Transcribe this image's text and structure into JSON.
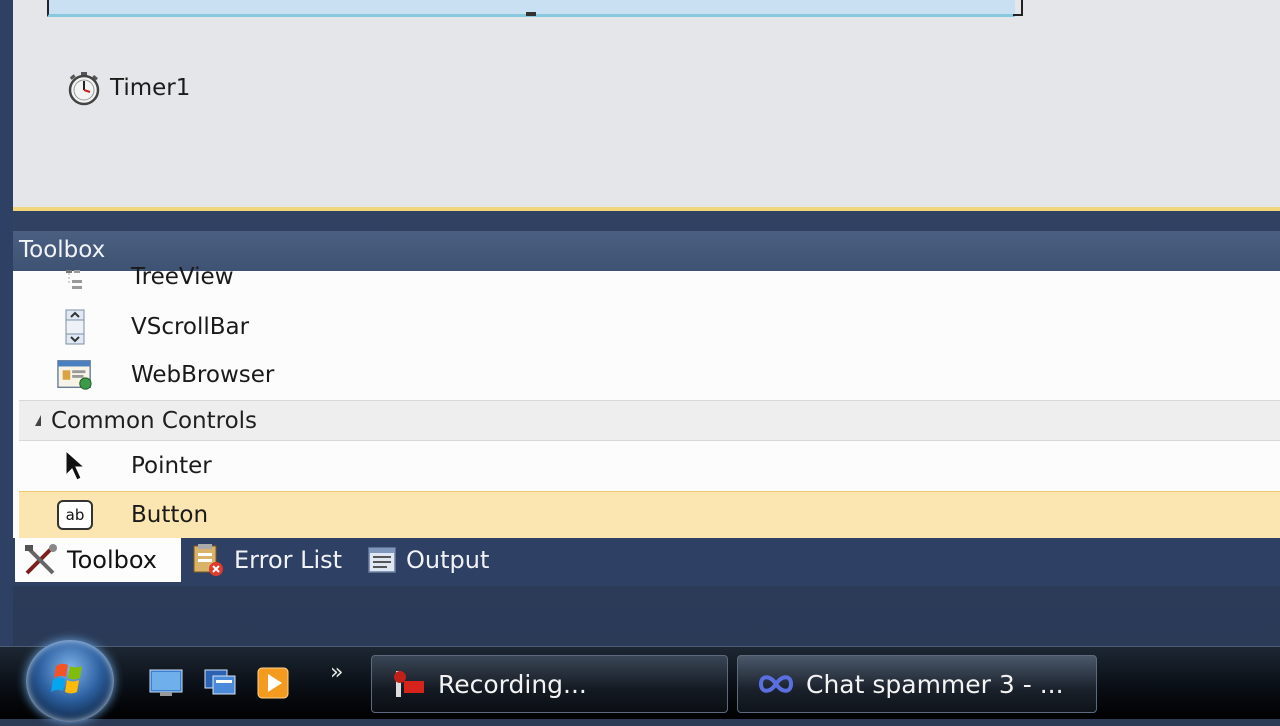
{
  "designer": {
    "component_tray": {
      "timer_label": "Timer1"
    }
  },
  "toolbox": {
    "title": "Toolbox",
    "items_above": [
      {
        "label": "TreeView",
        "icon": "treeview-icon"
      },
      {
        "label": "VScrollBar",
        "icon": "vscrollbar-icon"
      },
      {
        "label": "WebBrowser",
        "icon": "webbrowser-icon"
      }
    ],
    "group": {
      "label": "Common Controls"
    },
    "group_items": [
      {
        "label": "Pointer",
        "icon": "pointer-icon"
      },
      {
        "label": "Button",
        "icon": "button-control-icon",
        "icon_text": "ab"
      }
    ]
  },
  "tabs": [
    {
      "label": "Toolbox",
      "icon": "tools-icon"
    },
    {
      "label": "Error List",
      "icon": "error-list-icon"
    },
    {
      "label": "Output",
      "icon": "output-icon"
    }
  ],
  "taskbar": {
    "quick_launch_more": "»",
    "buttons": [
      {
        "label": "Recording...",
        "icon": "recording-icon"
      },
      {
        "label": "Chat spammer 3 - ...",
        "icon": "app-infinity-icon"
      }
    ]
  },
  "colors": {
    "selection": "#fbe5b0",
    "panel_header": "#46597b",
    "designer_bg": "#e4e6e9"
  }
}
